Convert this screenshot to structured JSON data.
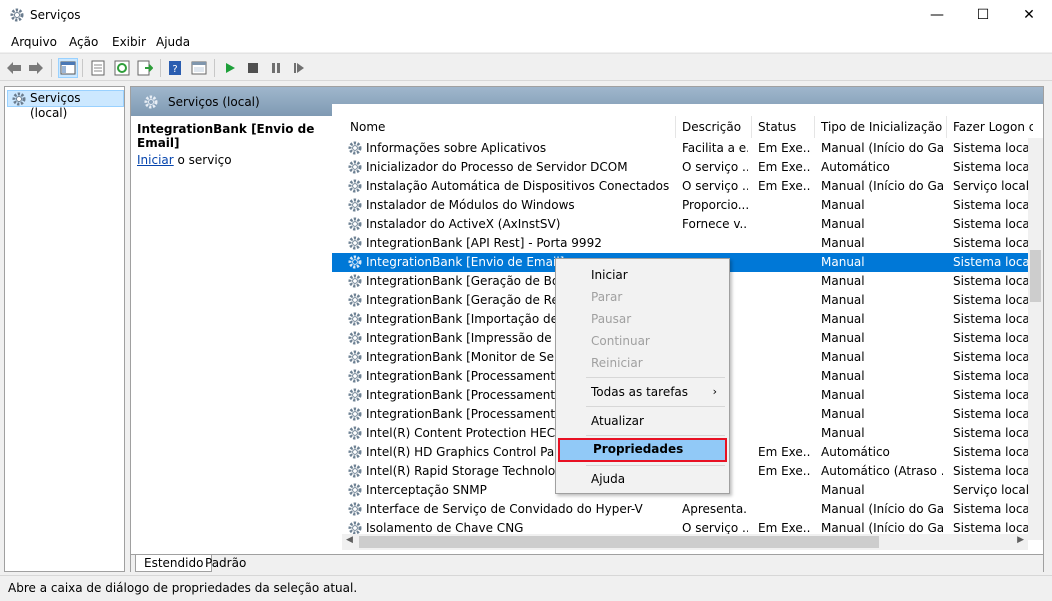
{
  "window": {
    "title": "Serviços",
    "minimize": "—",
    "maximize": "☐",
    "close": "✕"
  },
  "menubar": [
    "Arquivo",
    "Ação",
    "Exibir",
    "Ajuda"
  ],
  "toolbar_icons": [
    "back-arrow-icon",
    "forward-arrow-icon",
    "show-hide-tree-icon",
    "properties-sheet-icon",
    "refresh-icon",
    "export-list-icon",
    "help-icon",
    "console-view-icon",
    "play-icon",
    "stop-icon",
    "pause-icon",
    "restart-icon"
  ],
  "tree": {
    "root": "Serviços (local)"
  },
  "panel": {
    "header": "Serviços (local)",
    "selected_service": "IntegrationBank [Envio de Email]",
    "action_link": "Iniciar",
    "action_suffix": " o serviço"
  },
  "columns": [
    "Nome",
    "Descrição",
    "Status",
    "Tipo de Inicialização",
    "Fazer Logon co"
  ],
  "rows": [
    {
      "name": "Informações sobre Aplicativos",
      "desc": "Facilita a e...",
      "status": "Em Exe...",
      "startup": "Manual (Início do Ga...",
      "logon": "Sistema local"
    },
    {
      "name": "Inicializador do Processo de Servidor DCOM",
      "desc": "O serviço ...",
      "status": "Em Exe...",
      "startup": "Automático",
      "logon": "Sistema local"
    },
    {
      "name": "Instalação Automática de Dispositivos Conectados à Rede",
      "desc": "O serviço ...",
      "status": "Em Exe...",
      "startup": "Manual (Início do Ga...",
      "logon": "Serviço local"
    },
    {
      "name": "Instalador de Módulos do Windows",
      "desc": "Proporcio...",
      "status": "",
      "startup": "Manual",
      "logon": "Sistema local"
    },
    {
      "name": "Instalador do ActiveX (AxInstSV)",
      "desc": "Fornece v...",
      "status": "",
      "startup": "Manual",
      "logon": "Sistema local"
    },
    {
      "name": "IntegrationBank [API Rest] - Porta 9992",
      "desc": "",
      "status": "",
      "startup": "Manual",
      "logon": "Sistema local"
    },
    {
      "name": "IntegrationBank [Envio de Email]",
      "desc": "",
      "status": "",
      "startup": "Manual",
      "logon": "Sistema local",
      "selected": true
    },
    {
      "name": "IntegrationBank [Geração de Boleto",
      "desc": "",
      "status": "",
      "startup": "Manual",
      "logon": "Sistema local"
    },
    {
      "name": "IntegrationBank [Geração de Remess",
      "desc": "",
      "status": "",
      "startup": "Manual",
      "logon": "Sistema local"
    },
    {
      "name": "IntegrationBank [Importação de Reto",
      "desc": "",
      "status": "",
      "startup": "Manual",
      "logon": "Sistema local"
    },
    {
      "name": "IntegrationBank [Impressão de Boleto",
      "desc": "",
      "status": "",
      "startup": "Manual",
      "logon": "Sistema local"
    },
    {
      "name": "IntegrationBank [Monitor de Serviço",
      "desc": "",
      "status": "",
      "startup": "Manual",
      "logon": "Sistema local"
    },
    {
      "name": "IntegrationBank [Processamento de",
      "desc": "",
      "status": "",
      "startup": "Manual",
      "logon": "Sistema local"
    },
    {
      "name": "IntegrationBank [Processamento de",
      "desc": "",
      "status": "",
      "startup": "Manual",
      "logon": "Sistema local"
    },
    {
      "name": "IntegrationBank [Processamento de",
      "desc": "",
      "status": "",
      "startup": "Manual",
      "logon": "Sistema local"
    },
    {
      "name": "Intel(R) Content Protection HECI Ser",
      "desc": "",
      "status": "",
      "startup": "Manual",
      "logon": "Sistema local"
    },
    {
      "name": "Intel(R) HD Graphics Control Panel S",
      "desc": "",
      "status": "Em Exe...",
      "startup": "Automático",
      "logon": "Sistema local"
    },
    {
      "name": "Intel(R) Rapid Storage Technology",
      "desc": "",
      "status": "Em Exe...",
      "startup": "Automático (Atraso ...",
      "logon": "Sistema local"
    },
    {
      "name": "Interceptação SNMP",
      "desc": "",
      "status": "",
      "startup": "Manual",
      "logon": "Serviço local"
    },
    {
      "name": "Interface de Serviço de Convidado do Hyper-V",
      "desc": "Apresenta...",
      "status": "",
      "startup": "Manual (Início do Ga...",
      "logon": "Sistema local"
    },
    {
      "name": "Isolamento de Chave CNG",
      "desc": "O serviço ...",
      "status": "Em Exe...",
      "startup": "Manual (Início do Ga...",
      "logon": "Sistema local"
    }
  ],
  "context_menu": {
    "items": [
      {
        "label": "Iniciar",
        "enabled": true
      },
      {
        "label": "Parar",
        "enabled": false
      },
      {
        "label": "Pausar",
        "enabled": false
      },
      {
        "label": "Continuar",
        "enabled": false
      },
      {
        "label": "Reiniciar",
        "enabled": false
      },
      {
        "label": "Todas as tarefas",
        "enabled": true,
        "submenu": true
      },
      {
        "label": "Atualizar",
        "enabled": true
      },
      {
        "label": "Propriedades",
        "enabled": true,
        "highlighted": true
      },
      {
        "label": "Ajuda",
        "enabled": true
      }
    ],
    "submenu_arrow": "›"
  },
  "tabs": [
    "Estendido",
    "Padrão"
  ],
  "statusbar": "Abre a caixa de diálogo de propriedades da seleção atual.",
  "colors": {
    "selection": "#0078d7",
    "highlight_border": "#e81123",
    "highlight_bg": "#91c9f7",
    "header_gradient": "#8fa9c1"
  }
}
